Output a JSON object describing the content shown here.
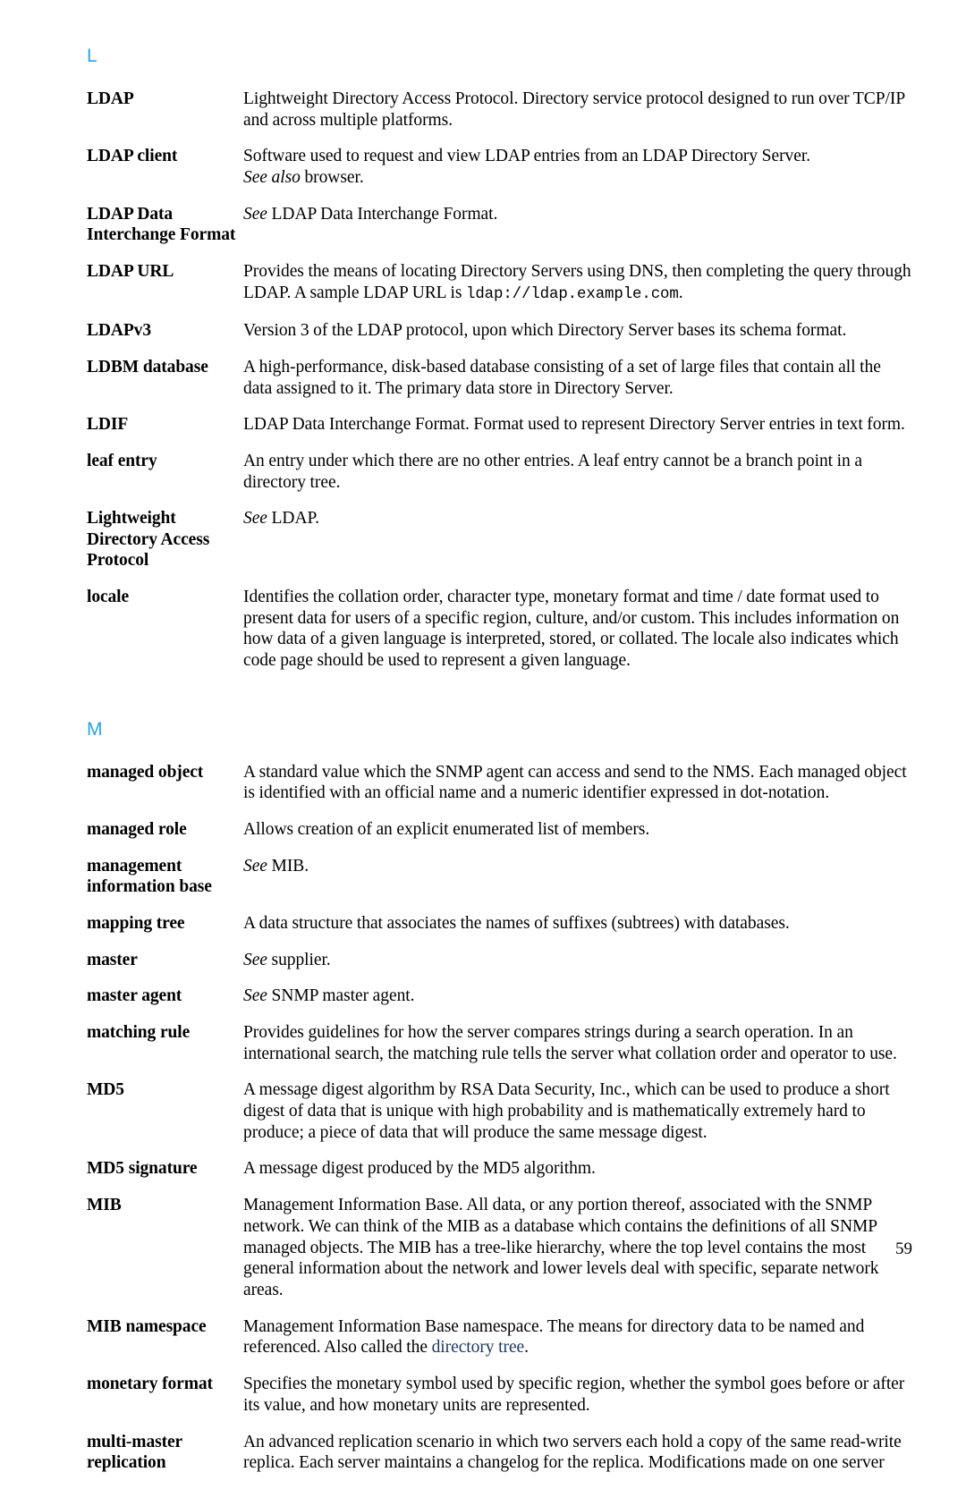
{
  "page": {
    "number": "59",
    "accent_color": "#2ba3dd",
    "link_color": "#1f3864",
    "text_color": "#000000",
    "background_color": "#ffffff"
  },
  "sections": [
    {
      "letter": "L",
      "entries": [
        {
          "term": "LDAP",
          "definition": "Lightweight Directory Access Protocol. Directory service protocol designed to run over TCP/IP and across multiple platforms."
        },
        {
          "term": "LDAP client",
          "def_part1": "Software used to request and view LDAP entries from an LDAP Directory Server.",
          "see_label": "See also",
          "see_target": " browser."
        },
        {
          "term": "LDAP Data Interchange Format",
          "see_label": "See",
          "see_target": " LDAP Data Interchange Format."
        },
        {
          "term": "LDAP URL",
          "def_part1": "Provides the means of locating Directory Servers using DNS, then completing the query through LDAP. A sample LDAP URL is ",
          "mono": "ldap://ldap.example.com",
          "def_part2": "."
        },
        {
          "term": "LDAPv3",
          "definition": "Version 3 of the LDAP protocol, upon which Directory Server bases its schema format."
        },
        {
          "term": "LDBM database",
          "definition": "A high-performance, disk-based database consisting of a set of large files that contain all the data assigned to it. The primary data store in Directory Server."
        },
        {
          "term": "LDIF",
          "definition": "LDAP Data Interchange Format. Format used to represent Directory Server entries in text form."
        },
        {
          "term": "leaf entry",
          "definition": "An entry under which there are no other entries. A leaf entry cannot be a branch point in a directory tree."
        },
        {
          "term": "Lightweight Directory Access Protocol",
          "see_label": "See",
          "see_target": " LDAP."
        },
        {
          "term": "locale",
          "definition": "Identifies the collation order, character type, monetary format and time / date format used to present data for users of a specific region, culture, and/or custom. This includes information on how data of a given language is interpreted, stored, or collated. The locale also indicates which code page should be used to represent a given language."
        }
      ]
    },
    {
      "letter": "M",
      "entries": [
        {
          "term": "managed object",
          "definition": "A standard value which the SNMP agent can access and send to the NMS. Each managed object is identified with an official name and a numeric identifier expressed in dot-notation."
        },
        {
          "term": "managed role",
          "definition": "Allows creation of an explicit enumerated list of members."
        },
        {
          "term": "management information base",
          "see_label": "See",
          "see_target": " MIB."
        },
        {
          "term": "mapping tree",
          "definition": "A data structure that associates the names of suffixes (subtrees) with databases."
        },
        {
          "term": "master",
          "see_label": "See",
          "see_target": " supplier."
        },
        {
          "term": "master agent",
          "see_label": "See",
          "see_target": " SNMP master agent."
        },
        {
          "term": "matching rule",
          "definition": "Provides guidelines for how the server compares strings during a search operation. In an international search, the matching rule tells the server what collation order and operator to use."
        },
        {
          "term": "MD5",
          "definition": "A message digest algorithm by RSA Data Security, Inc., which can be used to produce a short digest of data that is unique with high probability and is mathematically extremely hard to produce; a piece of data that will produce the same message digest."
        },
        {
          "term": "MD5 signature",
          "definition": "A message digest produced by the MD5 algorithm."
        },
        {
          "term": "MIB",
          "definition": "Management Information Base. All data, or any portion thereof, associated with the SNMP network. We can think of the MIB as a database which contains the definitions of all SNMP managed objects. The MIB has a tree-like hierarchy, where the top level contains the most general information about the network and lower levels deal with specific, separate network areas."
        },
        {
          "term": "MIB namespace",
          "def_part1": "Management Information Base namespace. The means for directory data to be named and referenced. Also called the ",
          "link": "directory tree",
          "def_part2": "."
        },
        {
          "term": "monetary format",
          "definition": "Specifies the monetary symbol used by specific region, whether the symbol goes before or after its value, and how monetary units are represented."
        },
        {
          "term": "multi-master replication",
          "definition": "An advanced replication scenario in which two servers each hold a copy of the same read-write replica. Each server maintains a changelog for the replica. Modifications made on one server"
        }
      ]
    }
  ]
}
